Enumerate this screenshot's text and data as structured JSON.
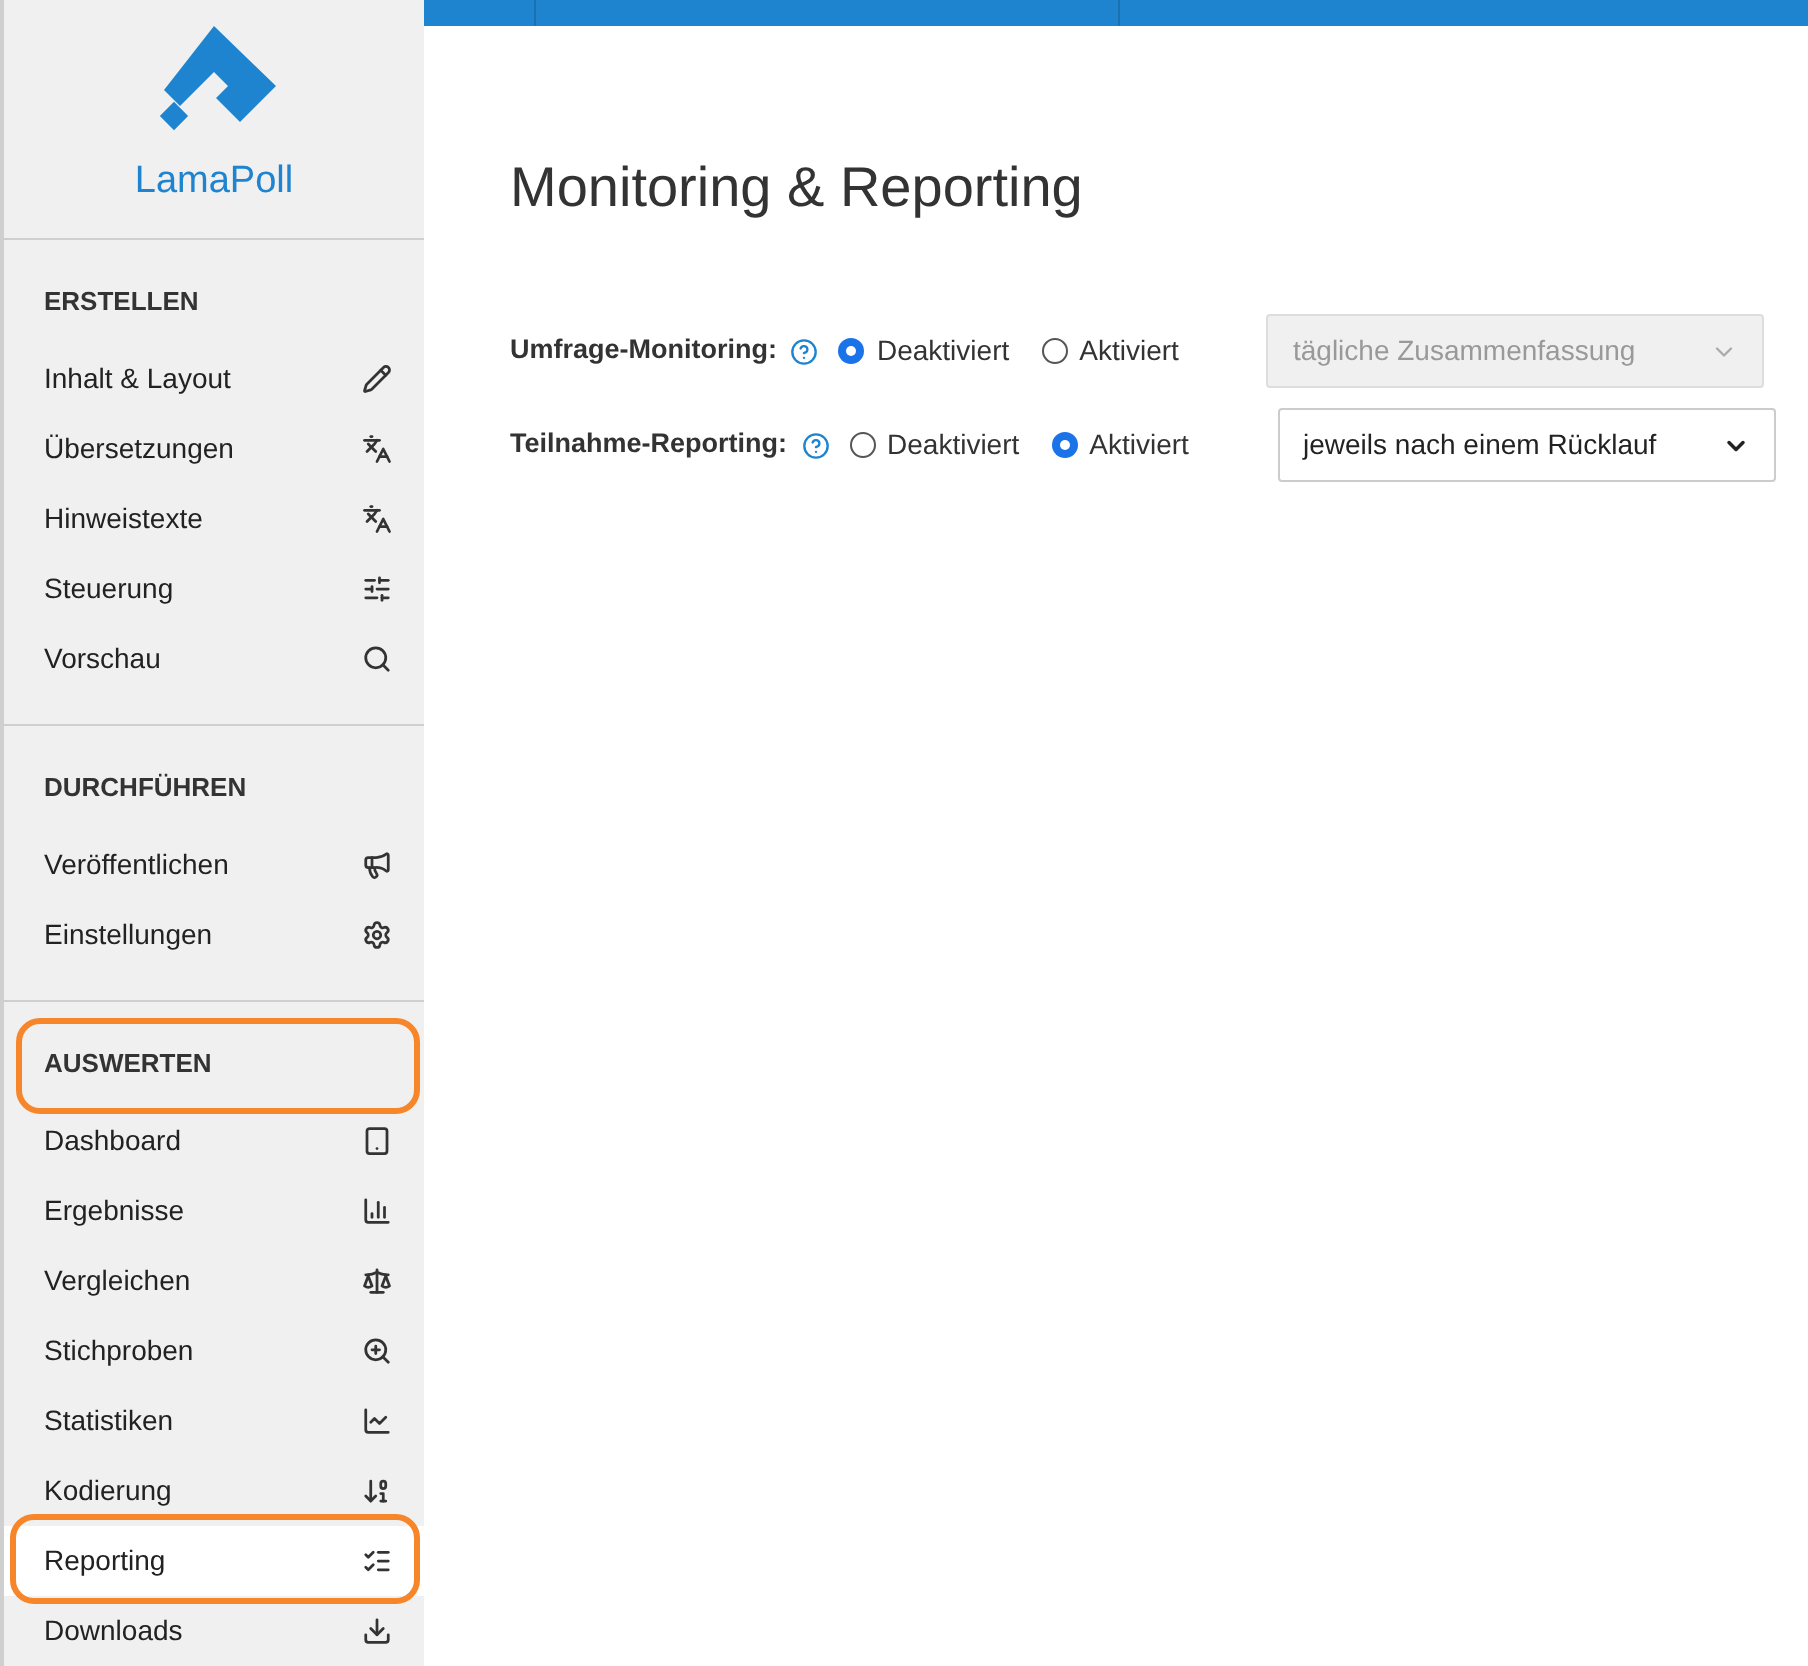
{
  "logo": {
    "text": "LamaPoll"
  },
  "sidebar": {
    "sections": [
      {
        "heading": "ERSTELLEN",
        "annotated": false,
        "items": [
          {
            "label": "Inhalt & Layout",
            "selected": false,
            "annotated": false
          },
          {
            "label": "Übersetzungen",
            "selected": false,
            "annotated": false
          },
          {
            "label": "Hinweistexte",
            "selected": false,
            "annotated": false
          },
          {
            "label": "Steuerung",
            "selected": false,
            "annotated": false
          },
          {
            "label": "Vorschau",
            "selected": false,
            "annotated": false
          }
        ]
      },
      {
        "heading": "DURCHFÜHREN",
        "annotated": false,
        "items": [
          {
            "label": "Veröffentlichen",
            "selected": false,
            "annotated": false
          },
          {
            "label": "Einstellungen",
            "selected": false,
            "annotated": false
          }
        ]
      },
      {
        "heading": "AUSWERTEN",
        "annotated": true,
        "items": [
          {
            "label": "Dashboard",
            "selected": false,
            "annotated": false
          },
          {
            "label": "Ergebnisse",
            "selected": false,
            "annotated": false
          },
          {
            "label": "Vergleichen",
            "selected": false,
            "annotated": false
          },
          {
            "label": "Stichproben",
            "selected": false,
            "annotated": false
          },
          {
            "label": "Statistiken",
            "selected": false,
            "annotated": false
          },
          {
            "label": "Kodierung",
            "selected": false,
            "annotated": false
          },
          {
            "label": "Reporting",
            "selected": true,
            "annotated": true
          },
          {
            "label": "Downloads",
            "selected": false,
            "annotated": false
          }
        ]
      }
    ]
  },
  "page": {
    "title": "Monitoring & Reporting",
    "settings": [
      {
        "label": "Umfrage-Monitoring:",
        "options": [
          {
            "label": "Deaktiviert",
            "selected": true
          },
          {
            "label": "Aktiviert",
            "selected": false
          }
        ],
        "select": {
          "value": "tägliche Zusammenfassung",
          "disabled": true
        }
      },
      {
        "label": "Teilnahme-Reporting:",
        "options": [
          {
            "label": "Deaktiviert",
            "selected": false
          },
          {
            "label": "Aktiviert",
            "selected": true
          }
        ],
        "select": {
          "value": "jeweils nach einem Rücklauf",
          "disabled": false
        }
      }
    ]
  }
}
